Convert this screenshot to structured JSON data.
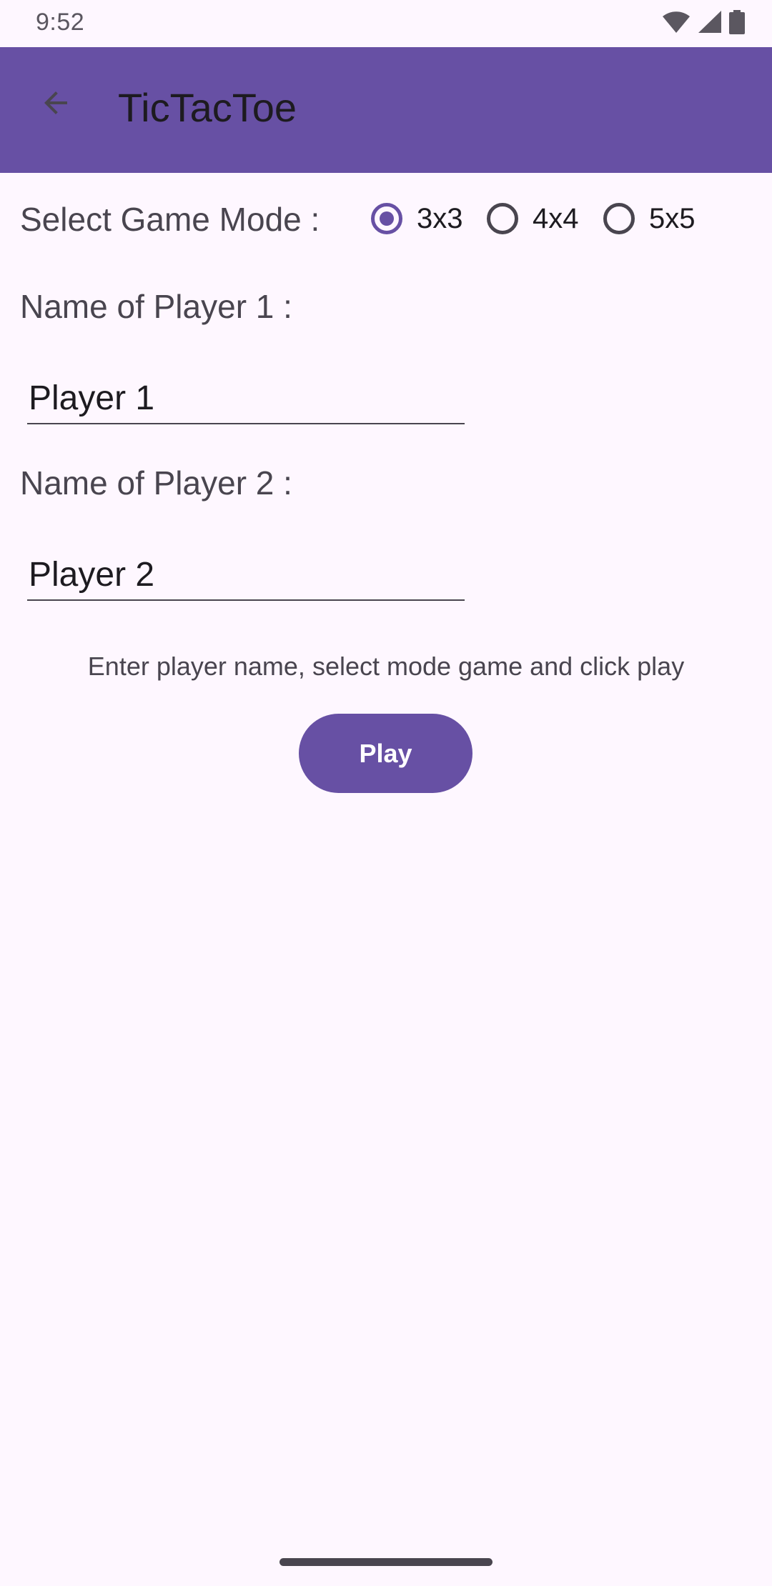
{
  "status_bar": {
    "time": "9:52",
    "icons": [
      "wifi-icon",
      "cellular-signal-icon",
      "battery-icon"
    ]
  },
  "app_bar": {
    "title": "TicTacToe",
    "back_icon": "arrow-back-icon",
    "color": "#6750A4"
  },
  "game_mode": {
    "label": "Select Game Mode :",
    "options": [
      {
        "label": "3x3",
        "checked": true
      },
      {
        "label": "4x4",
        "checked": false
      },
      {
        "label": "5x5",
        "checked": false
      }
    ]
  },
  "player1": {
    "label": "Name of Player 1 :",
    "value": "Player 1"
  },
  "player2": {
    "label": "Name of Player 2 :",
    "value": "Player 2"
  },
  "hint": "Enter player name, select mode game and click play",
  "play_button": {
    "label": "Play",
    "color": "#6750A4"
  }
}
